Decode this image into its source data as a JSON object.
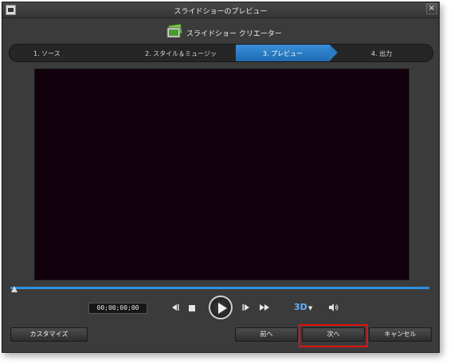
{
  "window": {
    "title": "スライドショーのプレビュー",
    "close_glyph": "×"
  },
  "header": {
    "app_name": "スライドショー クリエーター"
  },
  "steps": [
    {
      "label": "1. ソース"
    },
    {
      "label": "2. スタイル＆ミュージッ"
    },
    {
      "label": "3. プレビュー",
      "active": true
    },
    {
      "label": "4. 出力"
    }
  ],
  "player": {
    "timecode": "00;00;00;00",
    "mode_3d": "3D",
    "dropdown_glyph": "▼",
    "progress": 0
  },
  "buttons": {
    "customize": "カスタマイズ",
    "back": "前へ",
    "next": "次へ",
    "cancel": "キャンセル"
  },
  "colors": {
    "accent": "#2f8fe0",
    "highlight": "#e31212"
  }
}
